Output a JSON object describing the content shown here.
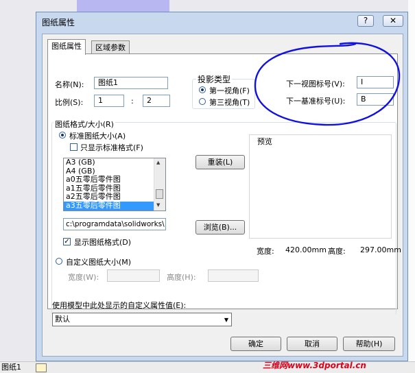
{
  "background": {
    "taskbar_tab": "图纸1",
    "watermark": "三维网www.3dportal.cn"
  },
  "dialog": {
    "title": "图纸属性",
    "help_glyph": "?",
    "close_glyph": "✕",
    "tabs": [
      "图纸属性",
      "区域参数"
    ],
    "name_label": "名称(N):",
    "name_value": "图纸1",
    "scale_label": "比例(S):",
    "scale_num": "1",
    "scale_sep": ":",
    "scale_den": "2",
    "projection": {
      "title": "投影类型",
      "first": "第一视角(F)",
      "third": "第三视角(T)",
      "selected": "first"
    },
    "next_view_label": "下一视图标号(V):",
    "next_view_value": "I",
    "next_datum_label": "下一基准标号(U):",
    "next_datum_value": "B",
    "format_group_title": "图纸格式/大小(R)",
    "standard_size_label": "标准图纸大小(A)",
    "only_standard_label": "只显示标准格式(F)",
    "only_standard_checked": false,
    "sizes": [
      "A3 (GB)",
      "A4 (GB)",
      "a0五零后零件图",
      "a1五零后零件图",
      "a2五零后零件图",
      "a3五零后零件图"
    ],
    "selected_size": "a3五零后零件图",
    "reload_button": "重装(L)",
    "path_value": "c:\\programdata\\solidworks\\",
    "browse_button": "浏览(B)...",
    "show_format_label": "显示图纸格式(D)",
    "show_format_checked": true,
    "custom_size_label": "自定义图纸大小(M)",
    "width_label": "宽度(W):",
    "height_label": "高度(H):",
    "preview_label": "预览",
    "preview_width_label": "宽度:",
    "preview_width_value": "420.00mm",
    "preview_height_label": "高度:",
    "preview_height_value": "297.00mm",
    "custom_property_label": "使用模型中此处显示的自定义属性值(E):",
    "custom_property_value": "默认",
    "ok_button": "确定",
    "cancel_button": "取消",
    "help_button": "帮助(H)"
  },
  "annotation_color": "#1010e0"
}
